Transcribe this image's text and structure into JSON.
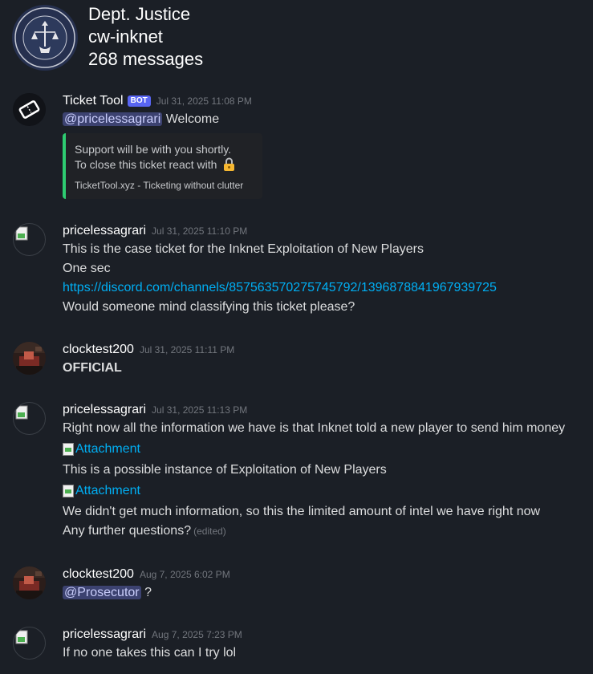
{
  "guild": {
    "name": "Dept. Justice",
    "channel": "cw-inknet",
    "message_count": "268 messages",
    "seal_text": "SEAL OF THE DEPARTMENT OF JUSTICE"
  },
  "messages": [
    {
      "author": "Ticket Tool",
      "bot_tag": "BOT",
      "timestamp": "Jul 31, 2025 11:08 PM",
      "mention": "@pricelessagrari",
      "text": "Welcome",
      "embed": {
        "line1": "Support will be with you shortly.",
        "line2": "To close this ticket react with",
        "footer": "TicketTool.xyz - Ticketing without clutter",
        "color": "#2ecc71"
      }
    },
    {
      "author": "pricelessagrari",
      "timestamp": "Jul 31, 2025 11:10 PM",
      "lines": [
        "This is the case ticket for the Inknet Exploitation of New Players",
        "One sec"
      ],
      "link": "https://discord.com/channels/857563570275745792/1396878841967939725",
      "after_link": "Would someone mind classifying this ticket please?"
    },
    {
      "author": "clocktest200",
      "timestamp": "Jul 31, 2025 11:11 PM",
      "text": "OFFICIAL"
    },
    {
      "author": "pricelessagrari",
      "timestamp": "Jul 31, 2025 11:13 PM",
      "line1": "Right now all the information we have is that Inknet told a new player to send him money",
      "attachment1": "Attachment",
      "line2": "This is a possible instance of Exploitation of New Players",
      "attachment2": "Attachment",
      "line3": "We didn't get much information, so this the limited amount of intel we have right now",
      "line4": "Any further questions?",
      "edited": "(edited)"
    },
    {
      "author": "clocktest200",
      "timestamp": "Aug 7, 2025 6:02 PM",
      "mention": "@Prosecutor",
      "text": "?"
    },
    {
      "author": "pricelessagrari",
      "timestamp": "Aug 7, 2025 7:23 PM",
      "text": "If no one takes this can I try lol"
    }
  ],
  "colors": {
    "background": "#1b1f26",
    "link": "#00aff4",
    "mention_bg": "#3c4270",
    "bot_tag": "#5865f2"
  }
}
